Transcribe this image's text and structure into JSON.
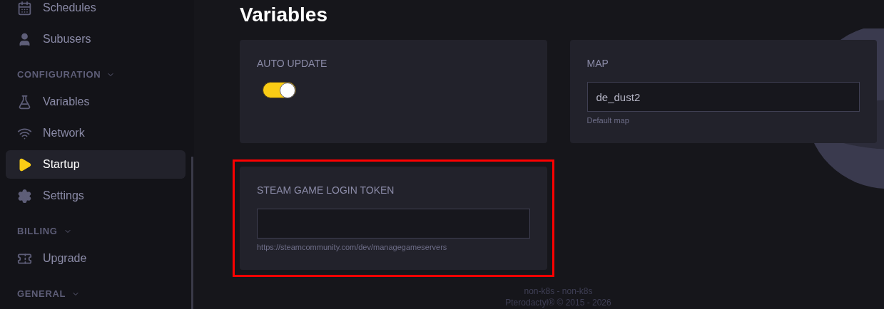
{
  "sidebar": {
    "sections": [
      {
        "items": [
          {
            "label": "Schedules",
            "kind": "calendar",
            "selected": false
          },
          {
            "label": "Subusers",
            "kind": "user",
            "selected": false
          }
        ]
      },
      {
        "heading": "CONFIGURATION",
        "items": [
          {
            "label": "Variables",
            "kind": "flask",
            "selected": false
          },
          {
            "label": "Network",
            "kind": "wifi",
            "selected": false
          },
          {
            "label": "Startup",
            "kind": "play",
            "selected": true
          },
          {
            "label": "Settings",
            "kind": "gear",
            "selected": false
          }
        ]
      },
      {
        "heading": "BILLING",
        "items": [
          {
            "label": "Upgrade",
            "kind": "ticket",
            "selected": false
          }
        ]
      },
      {
        "heading": "GENERAL"
      }
    ]
  },
  "page_title": "Variables",
  "variables": [
    {
      "kind": "toggle",
      "name": "AUTO UPDATE",
      "on": true,
      "highlighted": false
    },
    {
      "kind": "text",
      "name": "MAP",
      "value": "de_dust2",
      "description": "Default map",
      "highlighted": false
    },
    {
      "kind": "text",
      "name": "STEAM GAME LOGIN TOKEN",
      "description": "https://steamcommunity.com/dev/managegameservers",
      "highlighted": true
    }
  ],
  "footer": [
    "non-k8s - non-k8s",
    "Pterodactyl® © 2015 - 2026"
  ]
}
